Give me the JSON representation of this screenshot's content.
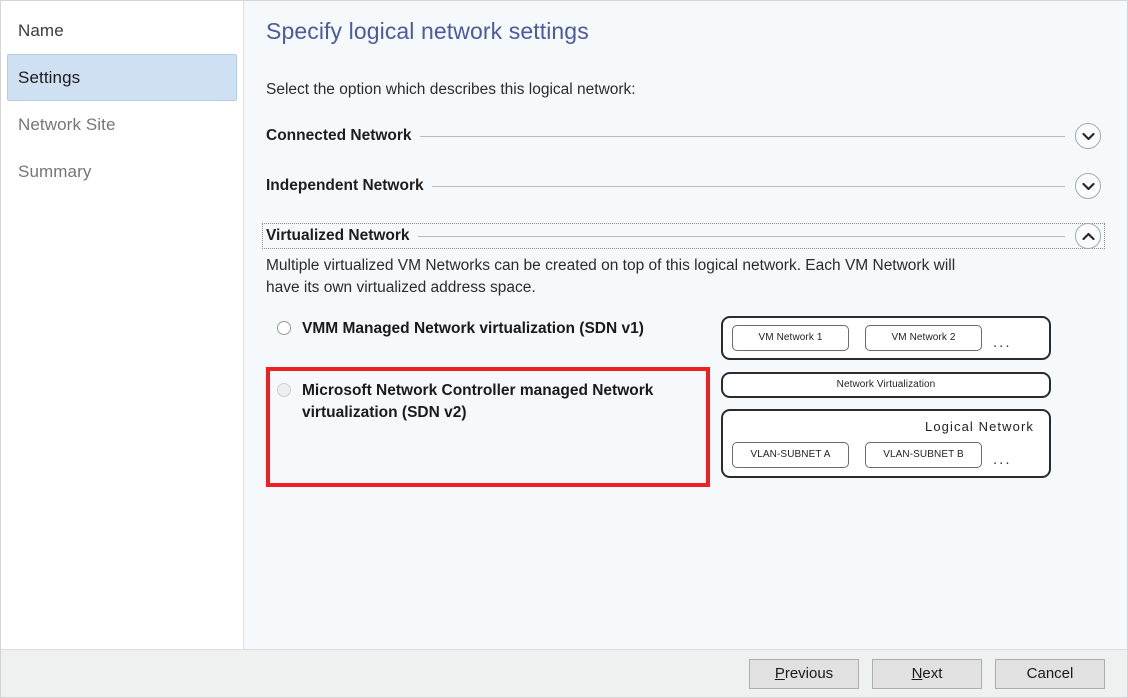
{
  "window": {
    "frame_border_color": "#d2d4d6"
  },
  "sidebar": {
    "items": [
      {
        "label": "Name",
        "state": "visited"
      },
      {
        "label": "Settings",
        "state": "selected"
      },
      {
        "label": "Network Site",
        "state": "upcoming"
      },
      {
        "label": "Summary",
        "state": "upcoming"
      }
    ],
    "selected_bg": "#cfe0f2"
  },
  "main": {
    "title": "Specify logical network settings",
    "intro": "Select the option which describes this logical network:",
    "title_color": "#4a5b9e",
    "sections": [
      {
        "title": "Connected Network",
        "expanded": false,
        "chevron": "chevron-down-icon"
      },
      {
        "title": "Independent Network",
        "expanded": false,
        "chevron": "chevron-down-icon"
      },
      {
        "title": "Virtualized Network",
        "expanded": true,
        "focused": true,
        "chevron": "chevron-up-icon",
        "description": "Multiple virtualized VM Networks can be created on top of this logical network. Each VM Network will have its own virtualized address space."
      }
    ],
    "options": [
      {
        "label": "VMM Managed Network virtualization (SDN v1)",
        "selected": false,
        "disabled": false
      },
      {
        "label": "Microsoft Network Controller managed Network virtualization (SDN v2)",
        "selected": false,
        "disabled": true
      }
    ],
    "annotation": {
      "color": "#ef2022",
      "target": "Microsoft Network Controller managed Network virtualization (SDN v2)"
    },
    "diagram": {
      "vm_networks": {
        "chips": [
          "VM Network 1",
          "VM Network 2"
        ],
        "ellipsis": "..."
      },
      "network_virtualization_label": "Network Virtualization",
      "logical_network": {
        "label": "Logical  Network",
        "chips": [
          "VLAN-SUBNET A",
          "VLAN-SUBNET B"
        ],
        "ellipsis": "..."
      }
    }
  },
  "footer": {
    "buttons": [
      {
        "accel": "P",
        "rest": "revious"
      },
      {
        "accel": "N",
        "rest": "ext"
      },
      {
        "accel": "",
        "rest": "Cancel"
      }
    ]
  }
}
